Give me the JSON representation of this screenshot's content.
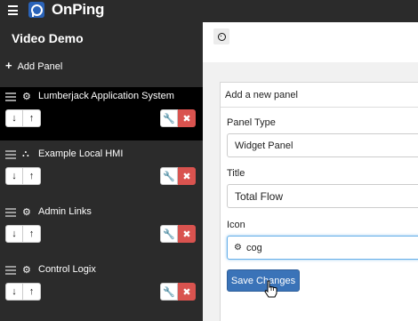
{
  "app": {
    "brand": "OnPing"
  },
  "sidebar": {
    "title": "Video Demo",
    "add_panel_label": "Add Panel",
    "panels": [
      {
        "name": "Lumberjack Application System",
        "icon": "cogs-icon",
        "active": true
      },
      {
        "name": "Example Local HMI",
        "icon": "sitemap-icon",
        "active": false
      },
      {
        "name": "Admin Links",
        "icon": "cogs-icon",
        "active": false
      },
      {
        "name": "Control Logix",
        "icon": "cog-icon",
        "active": false
      }
    ]
  },
  "form": {
    "heading": "Add a new panel",
    "panel_type_label": "Panel Type",
    "panel_type_value": "Widget Panel",
    "title_label": "Title",
    "title_value": "Total Flow",
    "icon_label": "Icon",
    "icon_value": "cog",
    "save_label": "Save Changes"
  },
  "colors": {
    "accent": "#3a73b8",
    "danger": "#d9534f",
    "sidebar_bg": "#2b2b2b",
    "active_row": "#000000"
  }
}
